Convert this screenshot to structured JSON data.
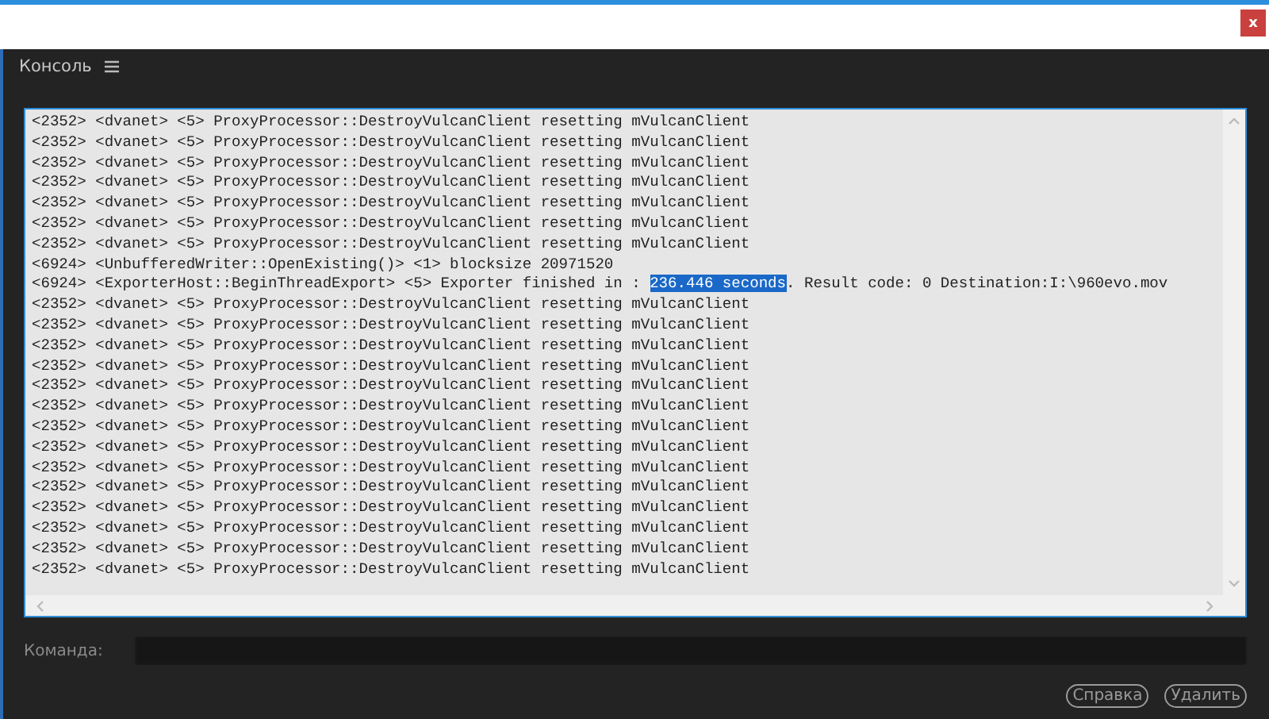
{
  "window": {
    "close_label": "x"
  },
  "panel": {
    "title": "Консоль"
  },
  "console": {
    "lines": [
      {
        "segments": [
          {
            "text": "<2352> <dvanet> <5> ProxyProcessor::DestroyVulcanClient resetting mVulcanClient",
            "selected": false
          }
        ]
      },
      {
        "segments": [
          {
            "text": "<2352> <dvanet> <5> ProxyProcessor::DestroyVulcanClient resetting mVulcanClient",
            "selected": false
          }
        ]
      },
      {
        "segments": [
          {
            "text": "<2352> <dvanet> <5> ProxyProcessor::DestroyVulcanClient resetting mVulcanClient",
            "selected": false
          }
        ]
      },
      {
        "segments": [
          {
            "text": "<2352> <dvanet> <5> ProxyProcessor::DestroyVulcanClient resetting mVulcanClient",
            "selected": false
          }
        ]
      },
      {
        "segments": [
          {
            "text": "<2352> <dvanet> <5> ProxyProcessor::DestroyVulcanClient resetting mVulcanClient",
            "selected": false
          }
        ]
      },
      {
        "segments": [
          {
            "text": "<2352> <dvanet> <5> ProxyProcessor::DestroyVulcanClient resetting mVulcanClient",
            "selected": false
          }
        ]
      },
      {
        "segments": [
          {
            "text": "<2352> <dvanet> <5> ProxyProcessor::DestroyVulcanClient resetting mVulcanClient",
            "selected": false
          }
        ]
      },
      {
        "segments": [
          {
            "text": "<6924> <UnbufferedWriter::OpenExisting()> <1> blocksize 20971520",
            "selected": false
          }
        ]
      },
      {
        "segments": [
          {
            "text": "<6924> <ExporterHost::BeginThreadExport> <5> Exporter finished in : ",
            "selected": false
          },
          {
            "text": "236.446 seconds",
            "selected": true
          },
          {
            "text": ". Result code: 0 Destination:I:\\960evo.mov",
            "selected": false
          }
        ]
      },
      {
        "segments": [
          {
            "text": "<2352> <dvanet> <5> ProxyProcessor::DestroyVulcanClient resetting mVulcanClient",
            "selected": false
          }
        ]
      },
      {
        "segments": [
          {
            "text": "<2352> <dvanet> <5> ProxyProcessor::DestroyVulcanClient resetting mVulcanClient",
            "selected": false
          }
        ]
      },
      {
        "segments": [
          {
            "text": "<2352> <dvanet> <5> ProxyProcessor::DestroyVulcanClient resetting mVulcanClient",
            "selected": false
          }
        ]
      },
      {
        "segments": [
          {
            "text": "<2352> <dvanet> <5> ProxyProcessor::DestroyVulcanClient resetting mVulcanClient",
            "selected": false
          }
        ]
      },
      {
        "segments": [
          {
            "text": "<2352> <dvanet> <5> ProxyProcessor::DestroyVulcanClient resetting mVulcanClient",
            "selected": false
          }
        ]
      },
      {
        "segments": [
          {
            "text": "<2352> <dvanet> <5> ProxyProcessor::DestroyVulcanClient resetting mVulcanClient",
            "selected": false
          }
        ]
      },
      {
        "segments": [
          {
            "text": "<2352> <dvanet> <5> ProxyProcessor::DestroyVulcanClient resetting mVulcanClient",
            "selected": false
          }
        ]
      },
      {
        "segments": [
          {
            "text": "<2352> <dvanet> <5> ProxyProcessor::DestroyVulcanClient resetting mVulcanClient",
            "selected": false
          }
        ]
      },
      {
        "segments": [
          {
            "text": "<2352> <dvanet> <5> ProxyProcessor::DestroyVulcanClient resetting mVulcanClient",
            "selected": false
          }
        ]
      },
      {
        "segments": [
          {
            "text": "<2352> <dvanet> <5> ProxyProcessor::DestroyVulcanClient resetting mVulcanClient",
            "selected": false
          }
        ]
      },
      {
        "segments": [
          {
            "text": "<2352> <dvanet> <5> ProxyProcessor::DestroyVulcanClient resetting mVulcanClient",
            "selected": false
          }
        ]
      },
      {
        "segments": [
          {
            "text": "<2352> <dvanet> <5> ProxyProcessor::DestroyVulcanClient resetting mVulcanClient",
            "selected": false
          }
        ]
      },
      {
        "segments": [
          {
            "text": "<2352> <dvanet> <5> ProxyProcessor::DestroyVulcanClient resetting mVulcanClient",
            "selected": false
          }
        ]
      },
      {
        "segments": [
          {
            "text": "<2352> <dvanet> <5> ProxyProcessor::DestroyVulcanClient resetting mVulcanClient",
            "selected": false
          }
        ]
      }
    ]
  },
  "command": {
    "label": "Команда:"
  },
  "buttons": [
    "Справка",
    "Удалить"
  ]
}
